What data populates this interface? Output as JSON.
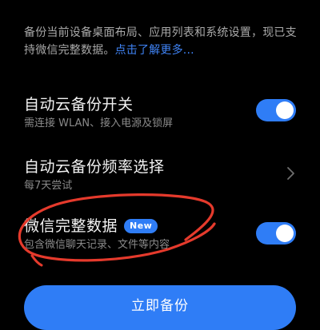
{
  "intro": {
    "text_line1": "备份当前设备桌面布局、应用列表和系统设置，现已支持微信完整数据。",
    "link": "点击了解更多..."
  },
  "settings": {
    "auto_backup": {
      "title": "自动云备份开关",
      "subtitle": "需连接 WLAN、接入电源及锁屏",
      "enabled": true
    },
    "frequency": {
      "title": "自动云备份频率选择",
      "subtitle": "每7天尝试"
    },
    "wechat": {
      "title": "微信完整数据",
      "badge": "New",
      "subtitle": "包含微信聊天记录、文件等内容",
      "enabled": true
    }
  },
  "action": {
    "backup_label": "立即备份"
  },
  "colors": {
    "accent": "#2f7df6",
    "annotation": "#e53a2c"
  },
  "icons": {
    "frequency_chevron": "chevron-right-icon"
  }
}
